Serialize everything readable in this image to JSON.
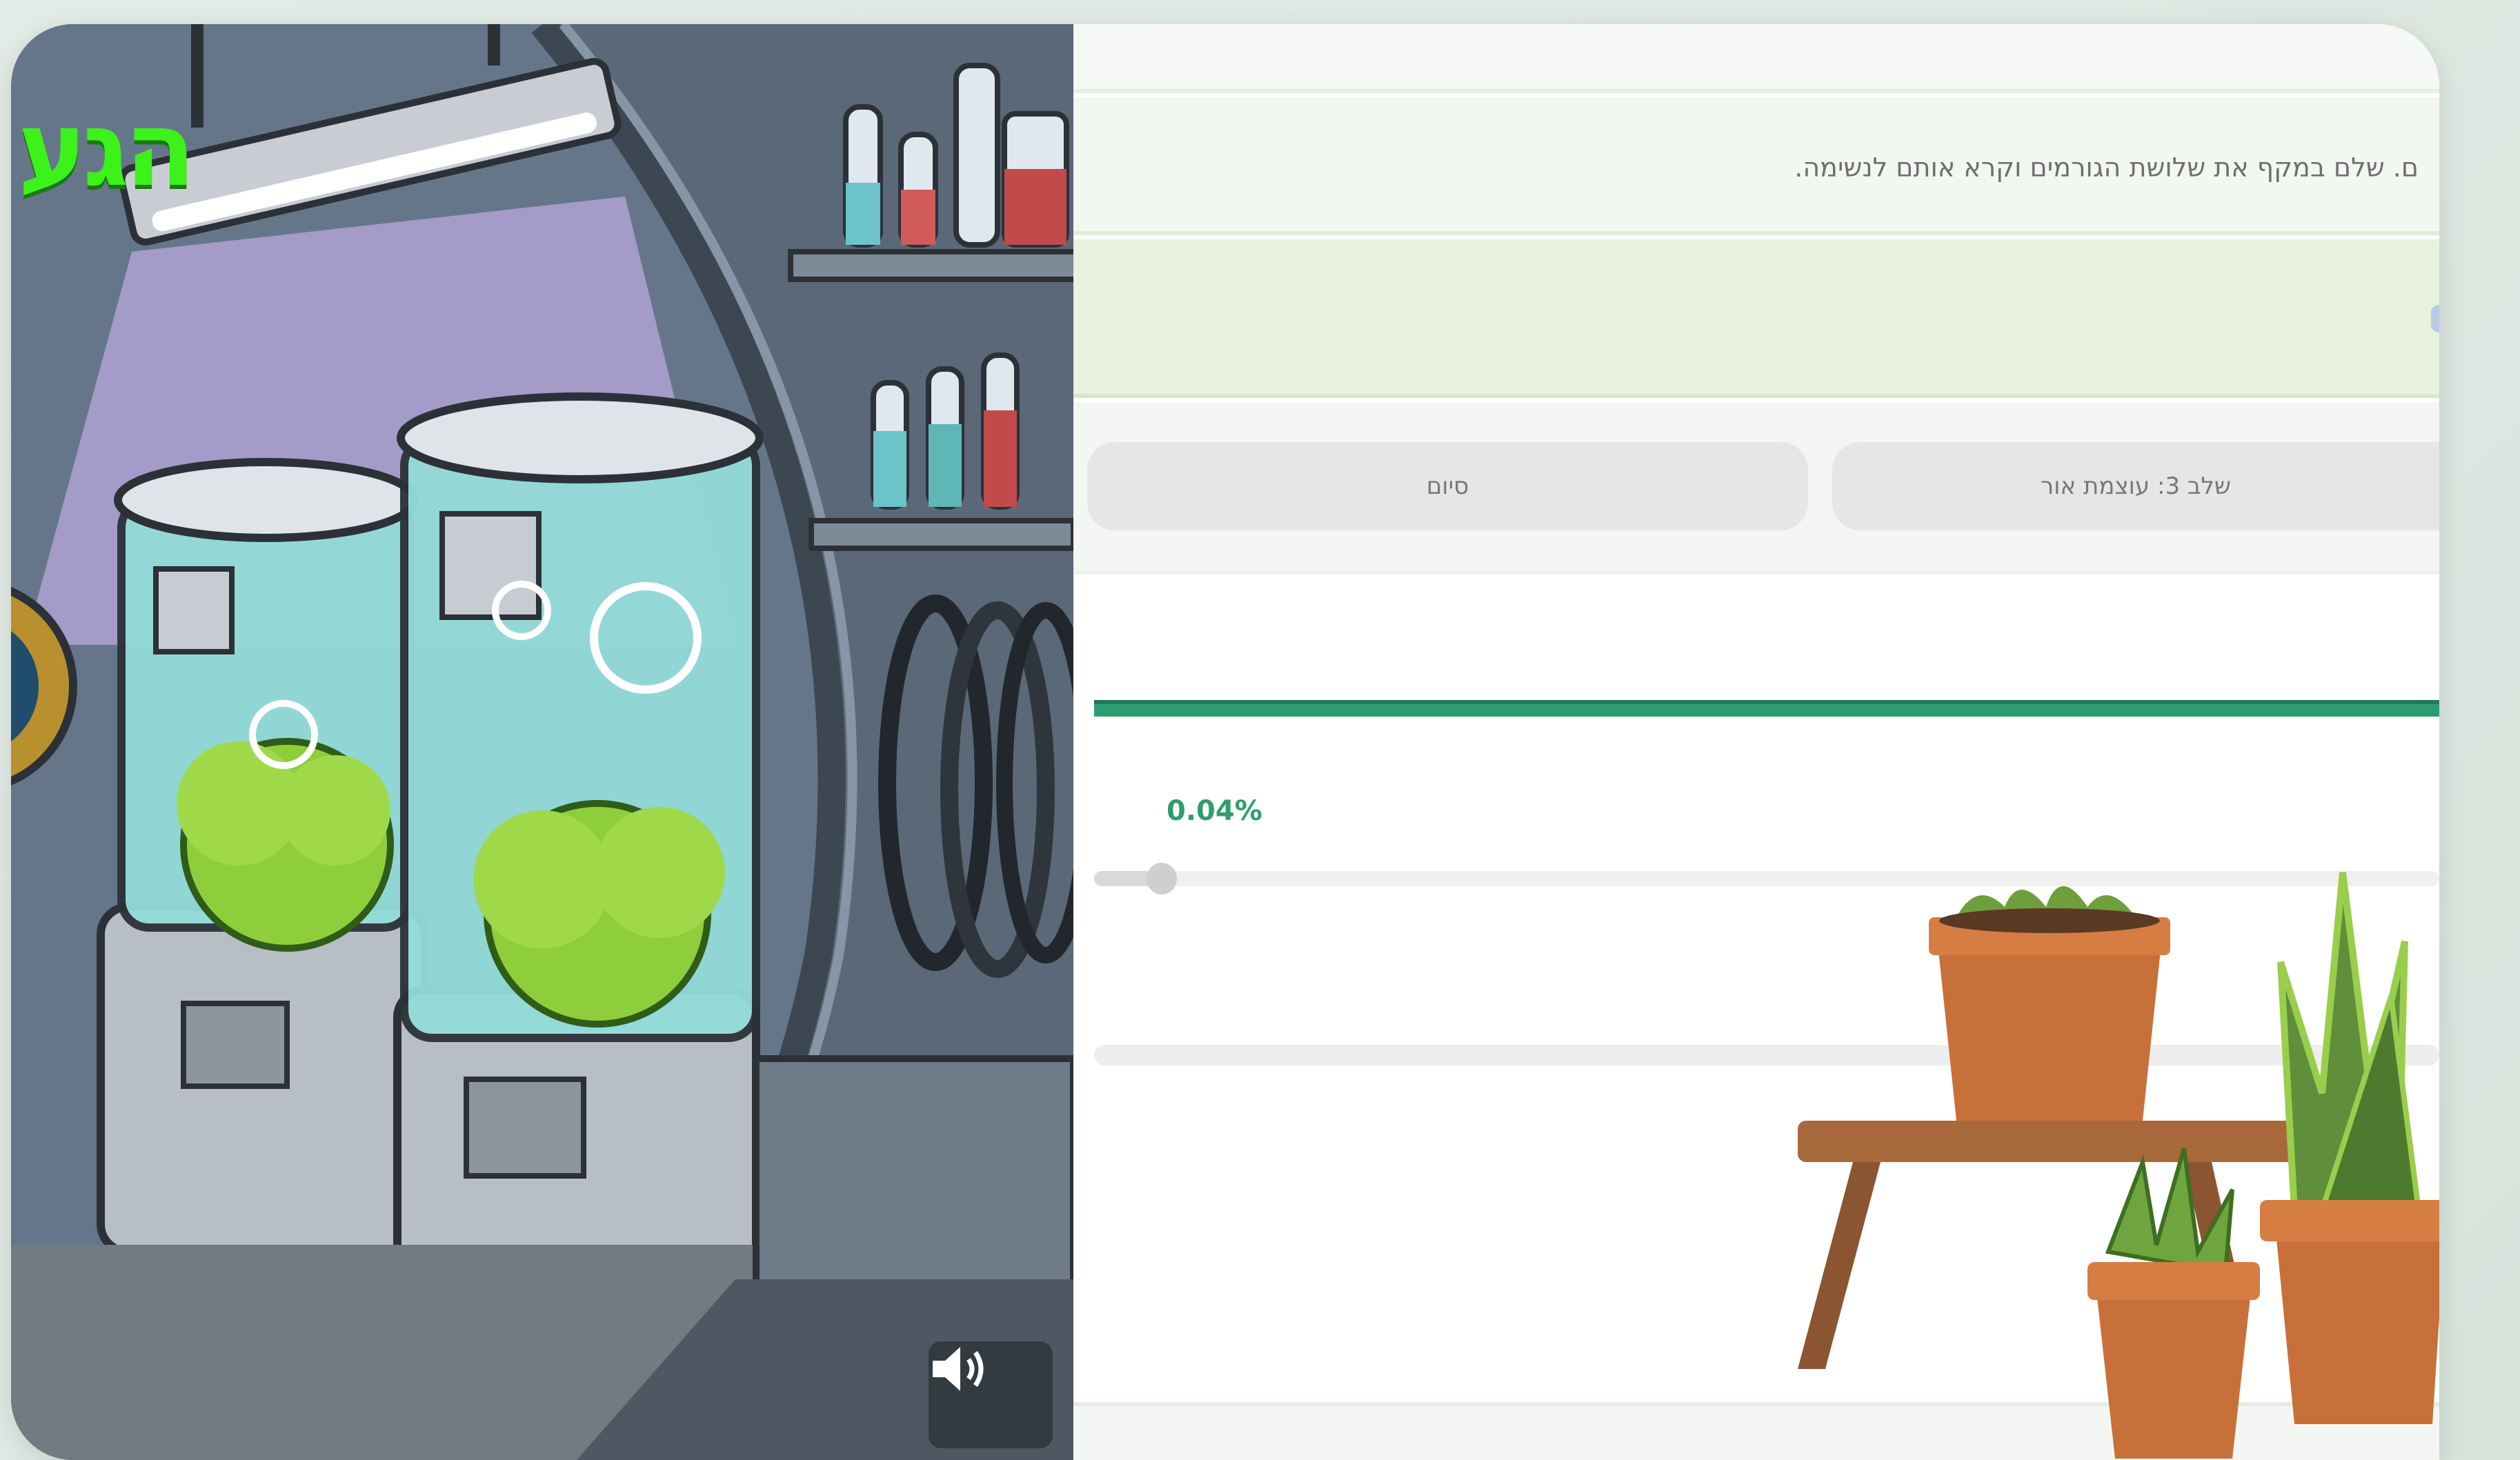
{
  "lab": {
    "title": "הגע",
    "sound_icon": "speaker-icon"
  },
  "panel": {
    "instructions": "ם. שלם במקף את שלושת הגורמים וקרא אותם לנשימה.",
    "steps": [
      {
        "label": "שלב 3: עוצמת אור"
      },
      {
        "label": "סיום"
      }
    ],
    "progress_percent_label": "0.04%",
    "progress_value": 0.0004,
    "slider_value_fraction": 0.05
  },
  "colors": {
    "accent": "#2d9c70",
    "lab_title": "#3df21a",
    "instructions_bg": "#e8f2dd"
  }
}
